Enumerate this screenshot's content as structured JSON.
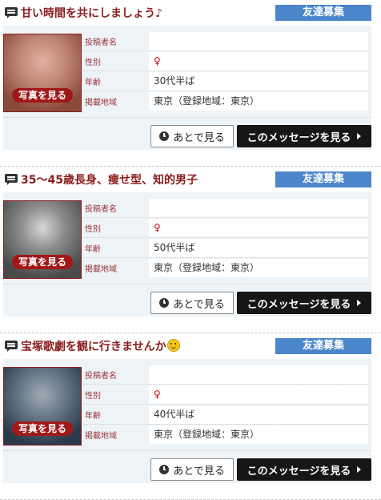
{
  "labels": {
    "poster": "投稿者名",
    "sex": "性別",
    "age": "年齢",
    "region": "掲載地域",
    "photo_button": "写真を見る",
    "later_button": "あとで見る",
    "view_button": "このメッセージを見る"
  },
  "posts": [
    {
      "title": "甘い時間を共にしましょう♪",
      "category": "友達募集",
      "poster": "",
      "sex": "♀",
      "age": "30代半ば",
      "region": "東京（登録地域：東京）",
      "photo_colors": [
        "#c28a7a",
        "#8a4a3a",
        "#e0b0a0"
      ]
    },
    {
      "title": "35～45歳長身、痩せ型、知的男子",
      "category": "友達募集",
      "poster": "",
      "sex": "♀",
      "age": "50代半ば",
      "region": "東京（登録地域：東京）",
      "photo_colors": [
        "#8c8c8c",
        "#4a4a4a",
        "#d8d8d8"
      ]
    },
    {
      "title": "宝塚歌劇を観に行きませんか",
      "title_emoji": "smiley-icon",
      "category": "友達募集",
      "poster": "",
      "sex": "♀",
      "age": "40代半ば",
      "region": "東京（登録地域：東京）",
      "photo_colors": [
        "#6a7a8a",
        "#2a3a4a",
        "#a0aab4"
      ]
    }
  ]
}
